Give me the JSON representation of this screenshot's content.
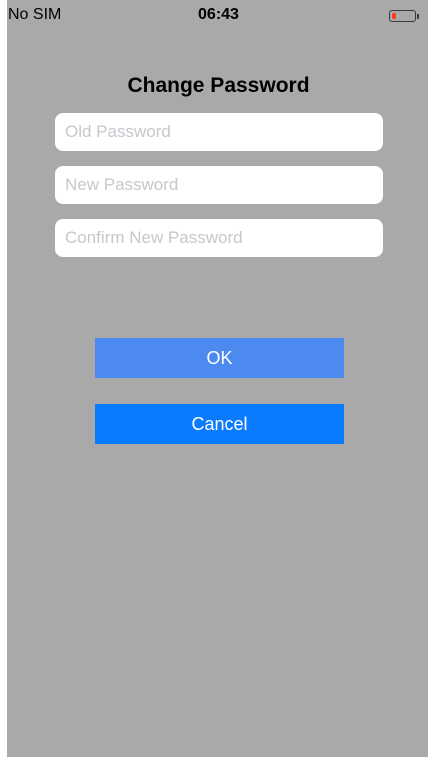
{
  "status_bar": {
    "carrier": "No SIM",
    "time": "06:43",
    "battery_icon": "battery-low-icon",
    "battery_level_color": "#ff3b30"
  },
  "page": {
    "title": "Change Password"
  },
  "form": {
    "old_password": {
      "value": "",
      "placeholder": "Old Password"
    },
    "new_password": {
      "value": "",
      "placeholder": "New Password"
    },
    "confirm_password": {
      "value": "",
      "placeholder": "Confirm New Password"
    }
  },
  "actions": {
    "ok": {
      "label": "OK",
      "color": "#4d8af0"
    },
    "cancel": {
      "label": "Cancel",
      "color": "#0a7aff"
    }
  },
  "colors": {
    "background": "#a9a9a9",
    "field_background": "#ffffff",
    "placeholder": "#c7c7cd"
  }
}
